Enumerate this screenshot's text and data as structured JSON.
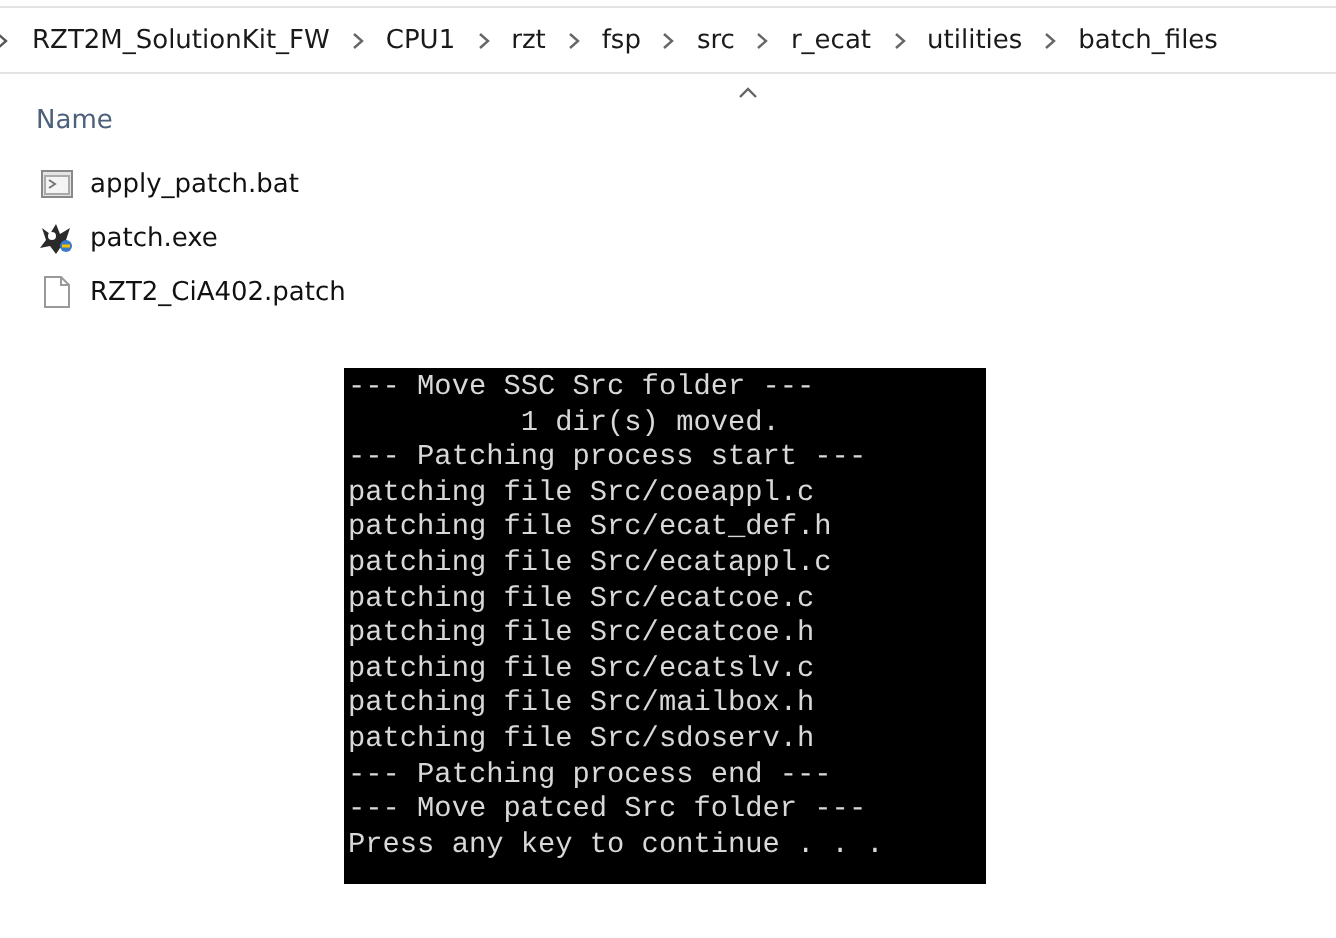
{
  "breadcrumb": [
    "RZT2M_SolutionKit_FW",
    "CPU1",
    "rzt",
    "fsp",
    "src",
    "r_ecat",
    "utilities",
    "batch_files"
  ],
  "file_list": {
    "column": "Name",
    "files": [
      {
        "name": "apply_patch.bat",
        "kind": "batch"
      },
      {
        "name": "patch.exe",
        "kind": "exe"
      },
      {
        "name": "RZT2_CiA402.patch",
        "kind": "file"
      }
    ]
  },
  "console": {
    "lines": [
      "--- Move SSC Src folder ---",
      "          1 dir(s) moved.",
      "--- Patching process start ---",
      "patching file Src/coeappl.c",
      "patching file Src/ecat_def.h",
      "patching file Src/ecatappl.c",
      "patching file Src/ecatcoe.c",
      "patching file Src/ecatcoe.h",
      "patching file Src/ecatslv.c",
      "patching file Src/mailbox.h",
      "patching file Src/sdoserv.h",
      "--- Patching process end ---",
      "--- Move patced Src folder ---",
      "Press any key to continue . . ."
    ]
  }
}
